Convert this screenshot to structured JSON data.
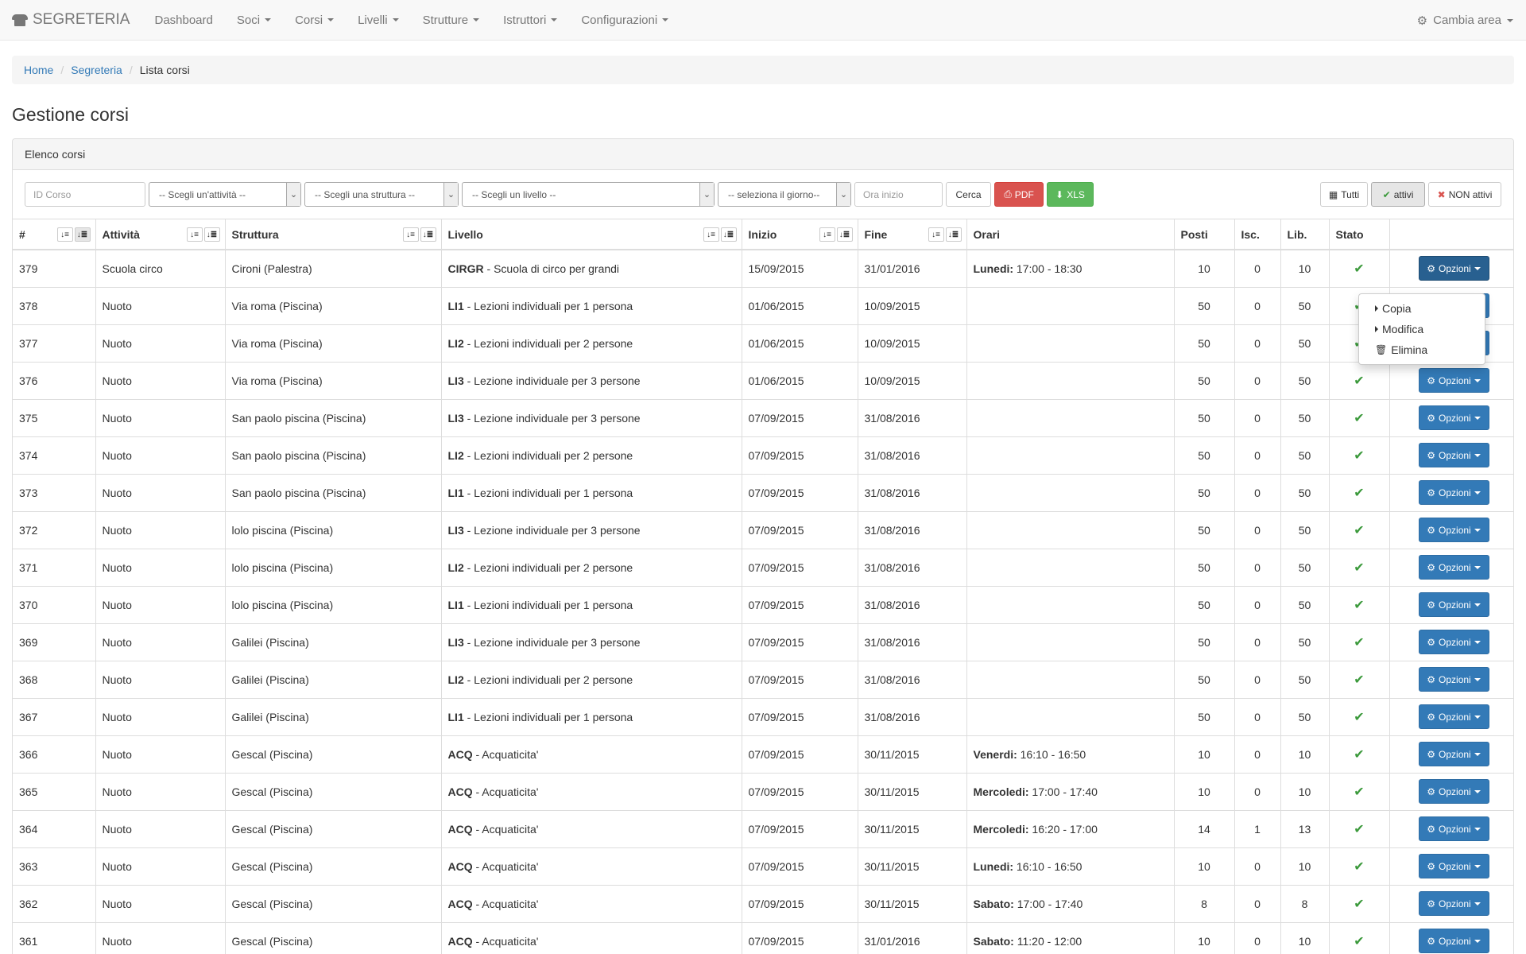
{
  "nav": {
    "brand": "SEGRETERIA",
    "items": [
      {
        "label": "Dashboard",
        "caret": false
      },
      {
        "label": "Soci",
        "caret": true
      },
      {
        "label": "Corsi",
        "caret": true
      },
      {
        "label": "Livelli",
        "caret": true
      },
      {
        "label": "Strutture",
        "caret": true
      },
      {
        "label": "Istruttori",
        "caret": true
      },
      {
        "label": "Configurazioni",
        "caret": true
      }
    ],
    "right": "Cambia area"
  },
  "breadcrumb": {
    "home": "Home",
    "segreteria": "Segreteria",
    "current": "Lista corsi"
  },
  "page_title": "Gestione corsi",
  "panel_title": "Elenco corsi",
  "filters": {
    "id_placeholder": "ID Corso",
    "activity": "-- Scegli un'attività --",
    "structure": "-- Scegli una struttura --",
    "level": "-- Scegli un livello --",
    "day": "-- seleziona il giorno--",
    "time_placeholder": "Ora inizio",
    "search": "Cerca",
    "pdf": "PDF",
    "xls": "XLS",
    "all": "Tutti",
    "active": "attivi",
    "inactive": "NON attivi"
  },
  "columns": [
    "#",
    "Attività",
    "Struttura",
    "Livello",
    "Inizio",
    "Fine",
    "Orari",
    "Posti",
    "Isc.",
    "Lib.",
    "Stato",
    ""
  ],
  "options_label": "Opzioni",
  "dropdown": [
    "Copia",
    "Modifica",
    "Elimina"
  ],
  "rows": [
    {
      "id": "379",
      "att": "Scuola circo",
      "str": "Cironi (Palestra)",
      "code": "CIRGR",
      "lvl": " - Scuola di circo per grandi",
      "start": "15/09/2015",
      "end": "31/01/2016",
      "day": "Lunedi:",
      "time": " 17:00 - 18:30",
      "posti": "10",
      "isc": "0",
      "lib": "10",
      "stato": "✔"
    },
    {
      "id": "378",
      "att": "Nuoto",
      "str": "Via roma (Piscina)",
      "code": "LI1",
      "lvl": " - Lezioni individuali per 1 persona",
      "start": "01/06/2015",
      "end": "10/09/2015",
      "day": "",
      "time": "",
      "posti": "50",
      "isc": "0",
      "lib": "50",
      "stato": "✔"
    },
    {
      "id": "377",
      "att": "Nuoto",
      "str": "Via roma (Piscina)",
      "code": "LI2",
      "lvl": " - Lezioni individuali per 2 persone",
      "start": "01/06/2015",
      "end": "10/09/2015",
      "day": "",
      "time": "",
      "posti": "50",
      "isc": "0",
      "lib": "50",
      "stato": "✔"
    },
    {
      "id": "376",
      "att": "Nuoto",
      "str": "Via roma (Piscina)",
      "code": "LI3",
      "lvl": " - Lezione individuale per 3 persone",
      "start": "01/06/2015",
      "end": "10/09/2015",
      "day": "",
      "time": "",
      "posti": "50",
      "isc": "0",
      "lib": "50",
      "stato": "✔"
    },
    {
      "id": "375",
      "att": "Nuoto",
      "str": "San paolo piscina (Piscina)",
      "code": "LI3",
      "lvl": " - Lezione individuale per 3 persone",
      "start": "07/09/2015",
      "end": "31/08/2016",
      "day": "",
      "time": "",
      "posti": "50",
      "isc": "0",
      "lib": "50",
      "stato": "✔"
    },
    {
      "id": "374",
      "att": "Nuoto",
      "str": "San paolo piscina (Piscina)",
      "code": "LI2",
      "lvl": " - Lezioni individuali per 2 persone",
      "start": "07/09/2015",
      "end": "31/08/2016",
      "day": "",
      "time": "",
      "posti": "50",
      "isc": "0",
      "lib": "50",
      "stato": "✔"
    },
    {
      "id": "373",
      "att": "Nuoto",
      "str": "San paolo piscina (Piscina)",
      "code": "LI1",
      "lvl": " - Lezioni individuali per 1 persona",
      "start": "07/09/2015",
      "end": "31/08/2016",
      "day": "",
      "time": "",
      "posti": "50",
      "isc": "0",
      "lib": "50",
      "stato": "✔"
    },
    {
      "id": "372",
      "att": "Nuoto",
      "str": "lolo piscina (Piscina)",
      "code": "LI3",
      "lvl": " - Lezione individuale per 3 persone",
      "start": "07/09/2015",
      "end": "31/08/2016",
      "day": "",
      "time": "",
      "posti": "50",
      "isc": "0",
      "lib": "50",
      "stato": "✔"
    },
    {
      "id": "371",
      "att": "Nuoto",
      "str": "lolo piscina (Piscina)",
      "code": "LI2",
      "lvl": " - Lezioni individuali per 2 persone",
      "start": "07/09/2015",
      "end": "31/08/2016",
      "day": "",
      "time": "",
      "posti": "50",
      "isc": "0",
      "lib": "50",
      "stato": "✔"
    },
    {
      "id": "370",
      "att": "Nuoto",
      "str": "lolo piscina (Piscina)",
      "code": "LI1",
      "lvl": " - Lezioni individuali per 1 persona",
      "start": "07/09/2015",
      "end": "31/08/2016",
      "day": "",
      "time": "",
      "posti": "50",
      "isc": "0",
      "lib": "50",
      "stato": "✔"
    },
    {
      "id": "369",
      "att": "Nuoto",
      "str": "Galilei (Piscina)",
      "code": "LI3",
      "lvl": " - Lezione individuale per 3 persone",
      "start": "07/09/2015",
      "end": "31/08/2016",
      "day": "",
      "time": "",
      "posti": "50",
      "isc": "0",
      "lib": "50",
      "stato": "✔"
    },
    {
      "id": "368",
      "att": "Nuoto",
      "str": "Galilei (Piscina)",
      "code": "LI2",
      "lvl": " - Lezioni individuali per 2 persone",
      "start": "07/09/2015",
      "end": "31/08/2016",
      "day": "",
      "time": "",
      "posti": "50",
      "isc": "0",
      "lib": "50",
      "stato": "✔"
    },
    {
      "id": "367",
      "att": "Nuoto",
      "str": "Galilei (Piscina)",
      "code": "LI1",
      "lvl": " - Lezioni individuali per 1 persona",
      "start": "07/09/2015",
      "end": "31/08/2016",
      "day": "",
      "time": "",
      "posti": "50",
      "isc": "0",
      "lib": "50",
      "stato": "✔"
    },
    {
      "id": "366",
      "att": "Nuoto",
      "str": "Gescal (Piscina)",
      "code": "ACQ",
      "lvl": " - Acquaticita'",
      "start": "07/09/2015",
      "end": "30/11/2015",
      "day": "Venerdi:",
      "time": " 16:10 - 16:50",
      "posti": "10",
      "isc": "0",
      "lib": "10",
      "stato": "✔"
    },
    {
      "id": "365",
      "att": "Nuoto",
      "str": "Gescal (Piscina)",
      "code": "ACQ",
      "lvl": " - Acquaticita'",
      "start": "07/09/2015",
      "end": "30/11/2015",
      "day": "Mercoledi:",
      "time": " 17:00 - 17:40",
      "posti": "10",
      "isc": "0",
      "lib": "10",
      "stato": "✔"
    },
    {
      "id": "364",
      "att": "Nuoto",
      "str": "Gescal (Piscina)",
      "code": "ACQ",
      "lvl": " - Acquaticita'",
      "start": "07/09/2015",
      "end": "30/11/2015",
      "day": "Mercoledi:",
      "time": " 16:20 - 17:00",
      "posti": "14",
      "isc": "1",
      "lib": "13",
      "stato": "✔"
    },
    {
      "id": "363",
      "att": "Nuoto",
      "str": "Gescal (Piscina)",
      "code": "ACQ",
      "lvl": " - Acquaticita'",
      "start": "07/09/2015",
      "end": "30/11/2015",
      "day": "Lunedi:",
      "time": " 16:10 - 16:50",
      "posti": "10",
      "isc": "0",
      "lib": "10",
      "stato": "✔"
    },
    {
      "id": "362",
      "att": "Nuoto",
      "str": "Gescal (Piscina)",
      "code": "ACQ",
      "lvl": " - Acquaticita'",
      "start": "07/09/2015",
      "end": "30/11/2015",
      "day": "Sabato:",
      "time": " 17:00 - 17:40",
      "posti": "8",
      "isc": "0",
      "lib": "8",
      "stato": "✔"
    },
    {
      "id": "361",
      "att": "Nuoto",
      "str": "Gescal (Piscina)",
      "code": "ACQ",
      "lvl": " - Acquaticita'",
      "start": "07/09/2015",
      "end": "31/01/2016",
      "day": "Sabato:",
      "time": " 11:20 - 12:00",
      "posti": "10",
      "isc": "0",
      "lib": "10",
      "stato": "✔"
    }
  ]
}
